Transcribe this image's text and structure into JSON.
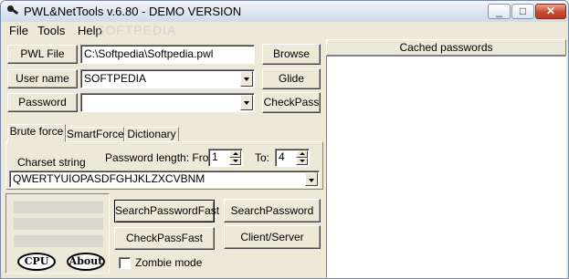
{
  "window": {
    "title": "PWL&NetTools v.6.80 - DEMO VERSION",
    "controls": {
      "minimize": "_",
      "maximize": "□",
      "close": "✕"
    }
  },
  "menu": [
    "File",
    "Tools",
    "Help"
  ],
  "watermark": "SOFTPEDIA",
  "fields": {
    "pwl_file": {
      "button": "PWL File",
      "value": "C:\\Softpedia\\Softpedia.pwl"
    },
    "user_name": {
      "button": "User name",
      "value": "SOFTPEDIA"
    },
    "password": {
      "button": "Password",
      "value": ""
    }
  },
  "side_buttons": {
    "browse": "Browse",
    "glide": "Glide",
    "checkpass": "CheckPass"
  },
  "tabs": [
    "Brute force",
    "SmartForce",
    "Dictionary"
  ],
  "active_tab": "Brute force",
  "brute": {
    "charset_label": "Charset string",
    "length_label": "Password length: From",
    "from": "1",
    "to_label": "To:",
    "to": "4",
    "charset": "QWERTYUIOPASDFGHJKLZXCVBNM"
  },
  "actions": {
    "search_fast": "SearchPasswordFast",
    "checkpass_fast": "CheckPassFast",
    "search": "SearchPassword",
    "client_server": "Client/Server",
    "zombie_mode": "Zombie mode",
    "cpu": "CPU",
    "about": "About"
  },
  "cached_passwords": {
    "header": "Cached passwords",
    "items": []
  }
}
